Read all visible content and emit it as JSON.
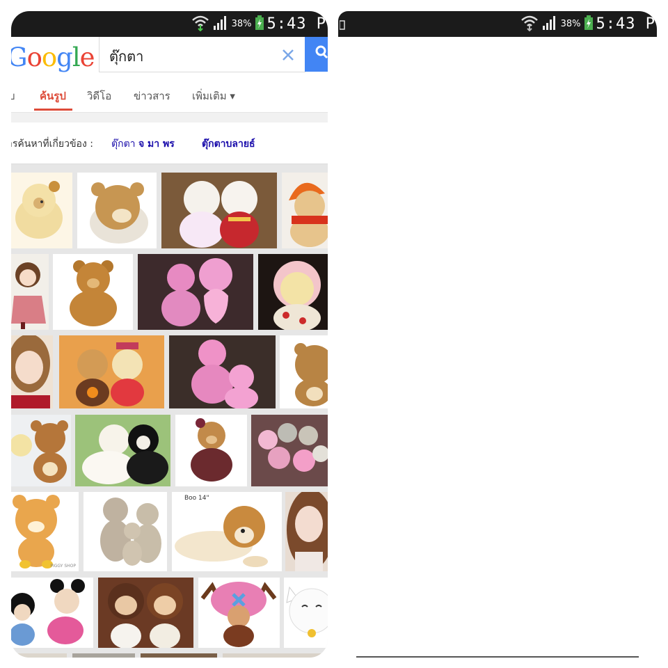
{
  "left_status": {
    "battery_pct": "38%",
    "time": "5:43 P"
  },
  "right_status": {
    "battery_pct": "38%",
    "time": "5:43 P"
  },
  "search": {
    "logo": "Google",
    "query": "ตุ๊กตา"
  },
  "tabs": [
    {
      "label": "ับ"
    },
    {
      "label": "ค้นรูป"
    },
    {
      "label": "วิดีโอ"
    },
    {
      "label": "ข่าวสาร"
    },
    {
      "label": "เพิ่มเติม ▾"
    }
  ],
  "related": {
    "label": "ารค้นหาที่เกี่ยวข้อง :",
    "link1_prefix": "ตุ๊กตา",
    "link1_bold": "จ มา พร",
    "link2": "ตุ๊กตาบลายธ์"
  },
  "thumb_captions": {
    "boo": "Boo 14\"",
    "shop": "PIGGY SHOP"
  },
  "images": [
    "cream-teddy",
    "rilakkuma",
    "couple-teddies",
    "orange-hat-bear",
    "doll-dress",
    "brown-teddy",
    "pink-bears-heart",
    "rilakkuma-pink-hood",
    "anime-doll",
    "rilakkuma-halloween",
    "pink-bears",
    "rilakkuma-brown",
    "rilakkuma-pair",
    "wedding-bears",
    "brown-teddy-dress",
    "pink-bear-group",
    "rilakkuma-orange",
    "grey-bears-family",
    "boo-dog",
    "long-hair-doll",
    "mickey-minnie",
    "monkeys",
    "chopper",
    "lucky-cat"
  ],
  "colors": {
    "accent_red": "#dd4b39",
    "google_blue": "#4285f4",
    "link": "#1a0dab",
    "statusbar": "#1b1b1b"
  }
}
